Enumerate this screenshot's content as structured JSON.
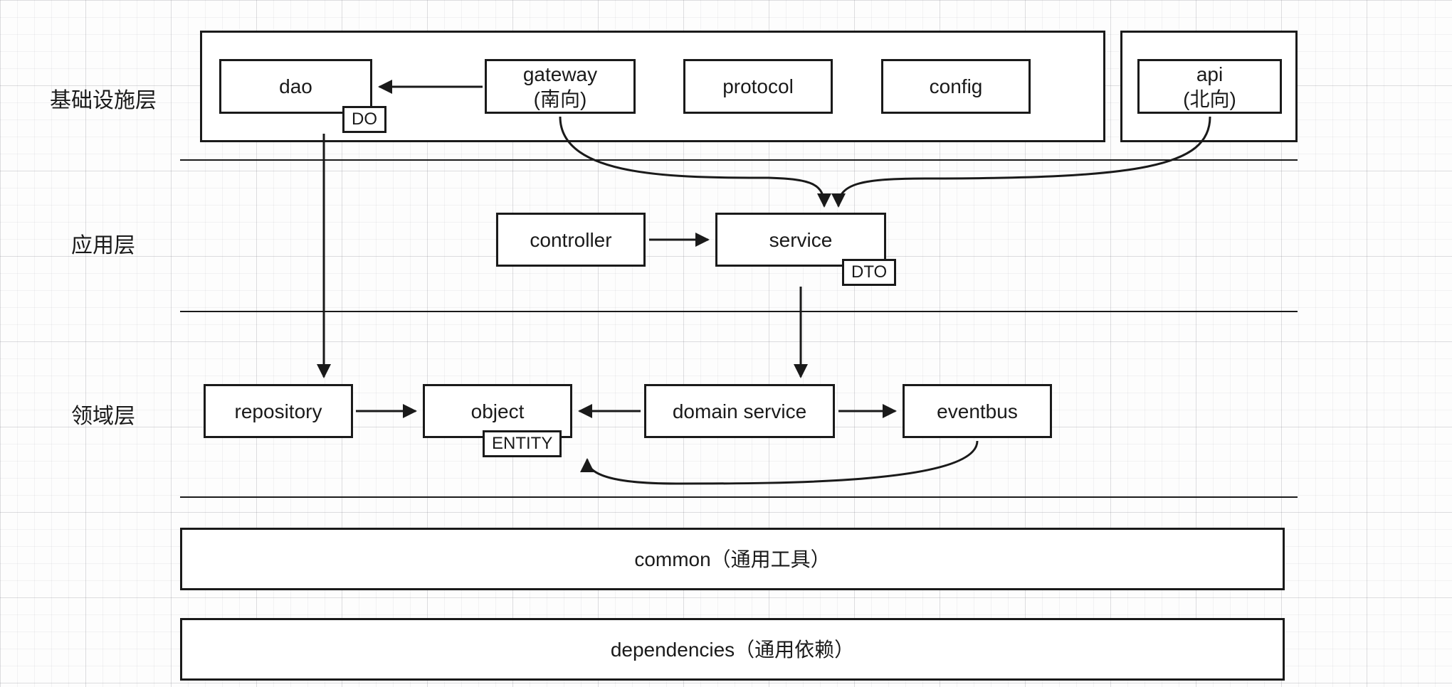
{
  "layers": {
    "infra": "基础设施层",
    "app": "应用层",
    "domain": "领域层"
  },
  "boxes": {
    "dao": "dao",
    "gateway_l1": "gateway",
    "gateway_l2": "(南向)",
    "protocol": "protocol",
    "config": "config",
    "api_l1": "api",
    "api_l2": "(北向)",
    "controller": "controller",
    "service": "service",
    "repository": "repository",
    "object": "object",
    "domain_service": "domain service",
    "eventbus": "eventbus",
    "common": "common（通用工具）",
    "dependencies": "dependencies（通用依赖）"
  },
  "tags": {
    "DO": "DO",
    "DTO": "DTO",
    "ENTITY": "ENTITY"
  }
}
